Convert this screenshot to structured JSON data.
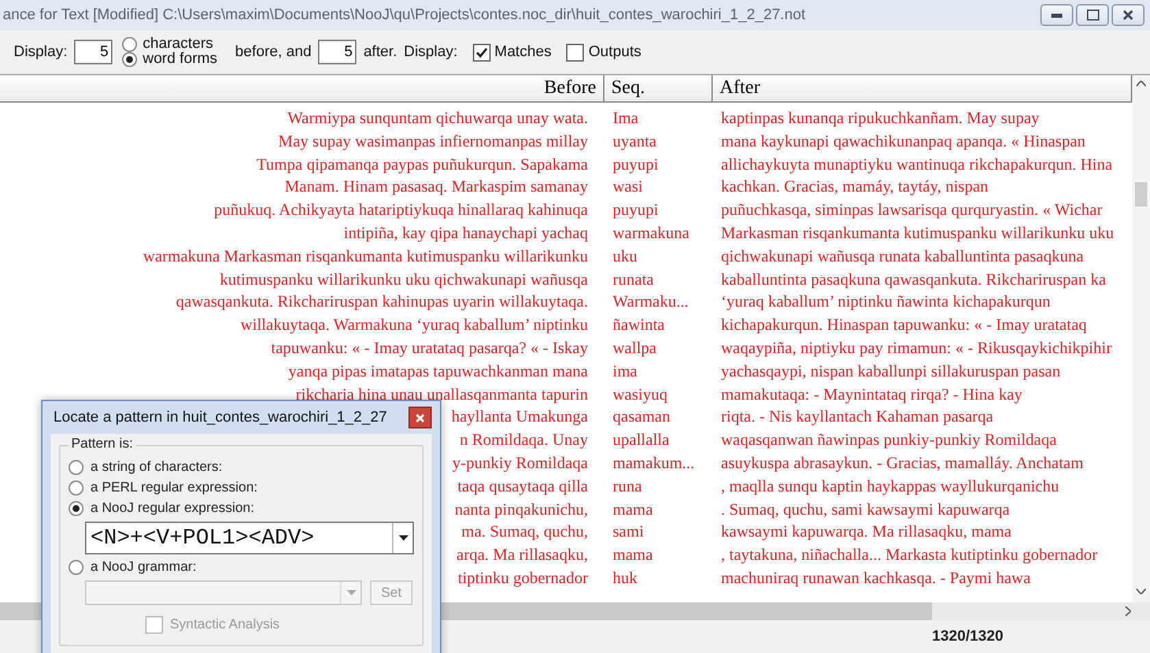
{
  "window": {
    "title": "ance for Text [Modified] C:\\Users\\maxim\\Documents\\NooJ\\qu\\Projects\\contes.noc_dir\\huit_contes_warochiri_1_2_27.not"
  },
  "toolbar": {
    "display_label": "Display:",
    "before_count": "5",
    "units": [
      {
        "label": "characters",
        "selected": false
      },
      {
        "label": "word forms",
        "selected": true
      }
    ],
    "before_label": "before, and",
    "after_count": "5",
    "after_label": "after.",
    "display2_label": "Display:",
    "checks": [
      {
        "label": "Matches",
        "checked": true
      },
      {
        "label": "Outputs",
        "checked": false
      }
    ]
  },
  "table": {
    "columns": [
      "Before",
      "Seq.",
      "After"
    ],
    "rows": [
      {
        "before": "Warmiypa sunquntam qichuwarqa unay wata.",
        "seq": "Ima",
        "after": "kaptinpas kunanqa ripukuchkanñam. May supay"
      },
      {
        "before": "May supay wasimanpas infiernomanpas millay",
        "seq": "uyanta",
        "after": "mana kaykunapi qawachikunanpaq apanqa.  « Hinaspan"
      },
      {
        "before": "Tumpa qipamanqa paypas puñukurqun. Sapakama",
        "seq": "puyupi",
        "after": "allichaykuyta munaptiyku wantinuqa rikchapakurqun. Hina"
      },
      {
        "before": "Manam. Hinam pasasaq. Markaspim samanay",
        "seq": "wasi",
        "after": "kachkan. Gracias, mamáy, taytáy, nispan"
      },
      {
        "before": "puñukuq. Achikyayta hatariptiykuqa hinallaraq kahinuqa",
        "seq": "puyupi",
        "after": "puñuchkasqa, siminpas lawsarisqa qurquryastin.  « Wichar"
      },
      {
        "before": "intipiña, kay qipa hanaychapi yachaq",
        "seq": "warmakuna",
        "after": "Markasman risqankumanta kutimuspanku willarikunku uku"
      },
      {
        "before": "warmakuna Markasman risqankumanta kutimuspanku willarikunku",
        "seq": "uku",
        "after": "qichwakunapi wañusqa runata kaballuntinta pasaqkuna"
      },
      {
        "before": "kutimuspanku willarikunku uku qichwakunapi wañusqa",
        "seq": "runata",
        "after": "kaballuntinta pasaqkuna qawasqankuta. Rikchariruspan ka"
      },
      {
        "before": "qawasqankuta. Rikchariruspan kahinupas uyarin willakuytaqa.",
        "seq": "Warmaku...",
        "after": "‘yuraq kaballum’ niptinku ñawinta kichapakurqun"
      },
      {
        "before": "willakuytaqa. Warmakuna ‘yuraq kaballum’ niptinku",
        "seq": "ñawinta",
        "after": "kichapakurqun. Hinaspan tapuwanku:  « - Imay uratataq"
      },
      {
        "before": "tapuwanku:  « - Imay uratataq pasarqa?  « - Iskay",
        "seq": "wallpa",
        "after": "waqaypiña, niptiyku pay rimamun:  « - Rikusqaykichikpihir"
      },
      {
        "before": "yanqa pipas imatapas tapuwachkanman mana",
        "seq": "ima",
        "after": "yachasqaypi, nispan kaballunpi sillakuruspan pasan"
      },
      {
        "before": "rikcharia hina unau unallasqanmanta tapurin",
        "seq": "wasiyuq",
        "after": "mamakutaqa:  - Maynintataq rirqa?  - Hina kay"
      },
      {
        "before": "hayllanta Umakunga",
        "seq": "qasaman",
        "after": "riqta.  - Nis kayllantach Kahaman pasarqa"
      },
      {
        "before": "n Romildaqa.  Unay",
        "seq": "upallalla",
        "after": "waqasqanwan ñawinpas punkiy-punkiy Romildaqa"
      },
      {
        "before": "y-punkiy Romildaqa",
        "seq": "mamakum...",
        "after": "asuykuspa abrasaykun.  - Gracias, mamalláy. Anchatam"
      },
      {
        "before": "taqa qusaytaqa qilla",
        "seq": "runa",
        "after": ", maqlla sunqu kaptin haykappas wayllukurqanichu"
      },
      {
        "before": "nanta pinqakunichu,",
        "seq": "mama",
        "after": ". Sumaq, quchu, sami kawsaymi kapuwarqa"
      },
      {
        "before": "ma. Sumaq, quchu,",
        "seq": "sami",
        "after": "kawsaymi kapuwarqa. Ma rillasaqku, mama"
      },
      {
        "before": "arqa. Ma rillasaqku,",
        "seq": "mama",
        "after": ", taytakuna, niñachalla...  Markasta kutiptinku gobernador"
      },
      {
        "before": "tiptinku gobernador",
        "seq": "huk",
        "after": "machuniraq runawan kachkasqa.  - Paymi hawa"
      }
    ]
  },
  "status": "1320/1320",
  "dialog": {
    "title": "Locate a pattern in huit_contes_warochiri_1_2_27",
    "group_label": "Pattern is:",
    "options": [
      {
        "label": "a string of characters:",
        "selected": false
      },
      {
        "label": "a PERL regular expression:",
        "selected": false
      },
      {
        "label": "a NooJ regular expression:",
        "selected": true,
        "field": {
          "value": "<N>+<V+POL1><ADV>",
          "disabled": false
        }
      },
      {
        "label": "a NooJ grammar:",
        "selected": false,
        "field": {
          "disabled": true,
          "button": "Set"
        }
      }
    ],
    "syntactic": {
      "label": "Syntactic Analysis",
      "checked": false,
      "disabled": true
    }
  }
}
